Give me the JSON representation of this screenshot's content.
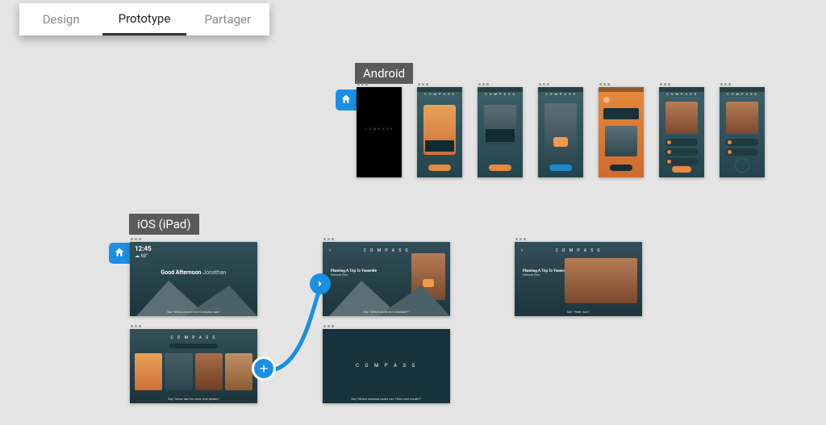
{
  "tabs": {
    "design": "Design",
    "prototype": "Prototype",
    "share": "Partager",
    "active": "prototype"
  },
  "sections": {
    "android": "Android",
    "ios": "iOS (iPad)"
  },
  "brand": "C O M P A S S",
  "android_artboards": [
    {
      "caption": ""
    },
    {
      "caption": ""
    },
    {
      "caption": ""
    },
    {
      "caption": ""
    },
    {
      "caption": ""
    },
    {
      "caption": ""
    },
    {
      "caption": ""
    }
  ],
  "ipad": {
    "home": {
      "time": "12:45",
      "temp": "68°",
      "greeting_strong": "Good Afternoon",
      "greeting_name": "Jonathan",
      "caption": "Say \"Alexa, launch the Compass app\""
    },
    "cards": {
      "caption": "Say \"Alexa tap the color tree please\""
    },
    "plan": {
      "title": "Planning A Trip To Yosemite",
      "sub": "National Park.",
      "caption": "Say \"Which dates are available?\""
    },
    "blank": {
      "caption": "Say \"Which national parks can I find next month?\""
    },
    "detail": {
      "title": "Planning A Trip To Yosemite",
      "sub": "National Park.",
      "caption": "Say \"Yeah, sure\""
    }
  }
}
